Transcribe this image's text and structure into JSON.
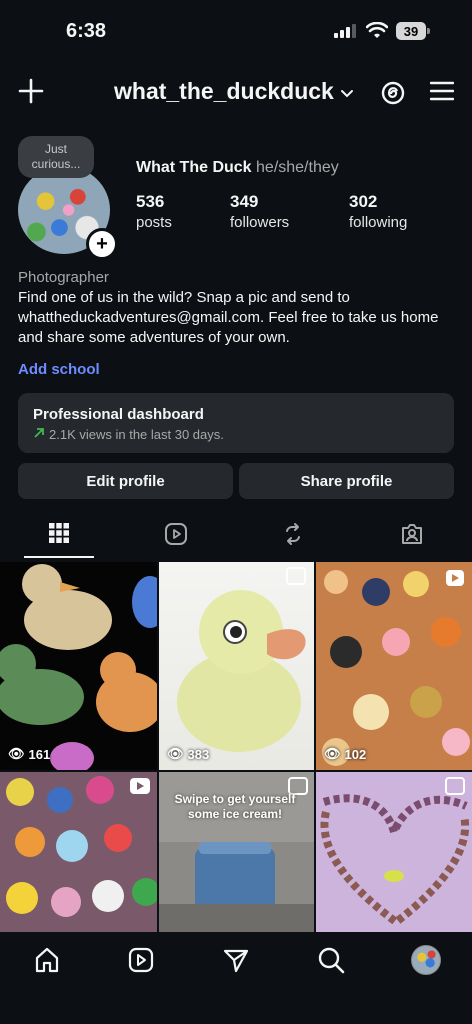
{
  "status_bar": {
    "time": "6:38",
    "battery": "39"
  },
  "header": {
    "username": "what_the_duckduck"
  },
  "profile": {
    "note": [
      "Just",
      "curious..."
    ],
    "display_name": "What The Duck",
    "pronouns": "he/she/they",
    "stats": [
      {
        "value": "536",
        "label": "posts"
      },
      {
        "value": "349",
        "label": "followers"
      },
      {
        "value": "302",
        "label": "following"
      }
    ],
    "category": "Photographer",
    "bio": "Find one of us in the wild? Snap a pic and send to whattheduckadventures@gmail.com. Feel free to take us home and share some adventures of your own.",
    "add_school": "Add school"
  },
  "dashboard": {
    "title": "Professional dashboard",
    "subtitle": "2.1K views in the last 30 days."
  },
  "buttons": {
    "edit": "Edit profile",
    "share": "Share profile"
  },
  "tabs": [
    "grid-icon",
    "reels-icon",
    "reposts-icon",
    "tagged-icon"
  ],
  "posts": [
    {
      "views": "161",
      "type": "reel"
    },
    {
      "views": "383",
      "type": "carousel"
    },
    {
      "views": "102",
      "type": "reel"
    },
    {
      "views": "",
      "type": "reel"
    },
    {
      "views": "",
      "type": "carousel",
      "overlay_text": "Swipe to get yourself some ice cream!"
    },
    {
      "views": "",
      "type": "carousel"
    }
  ],
  "nav": [
    "home-icon",
    "reels-icon",
    "send-icon",
    "search-icon",
    "profile-avatar"
  ],
  "colors": {
    "background": "#0c1014",
    "surface": "#25292e",
    "link": "#6e8cff",
    "trend": "#3fb950"
  }
}
